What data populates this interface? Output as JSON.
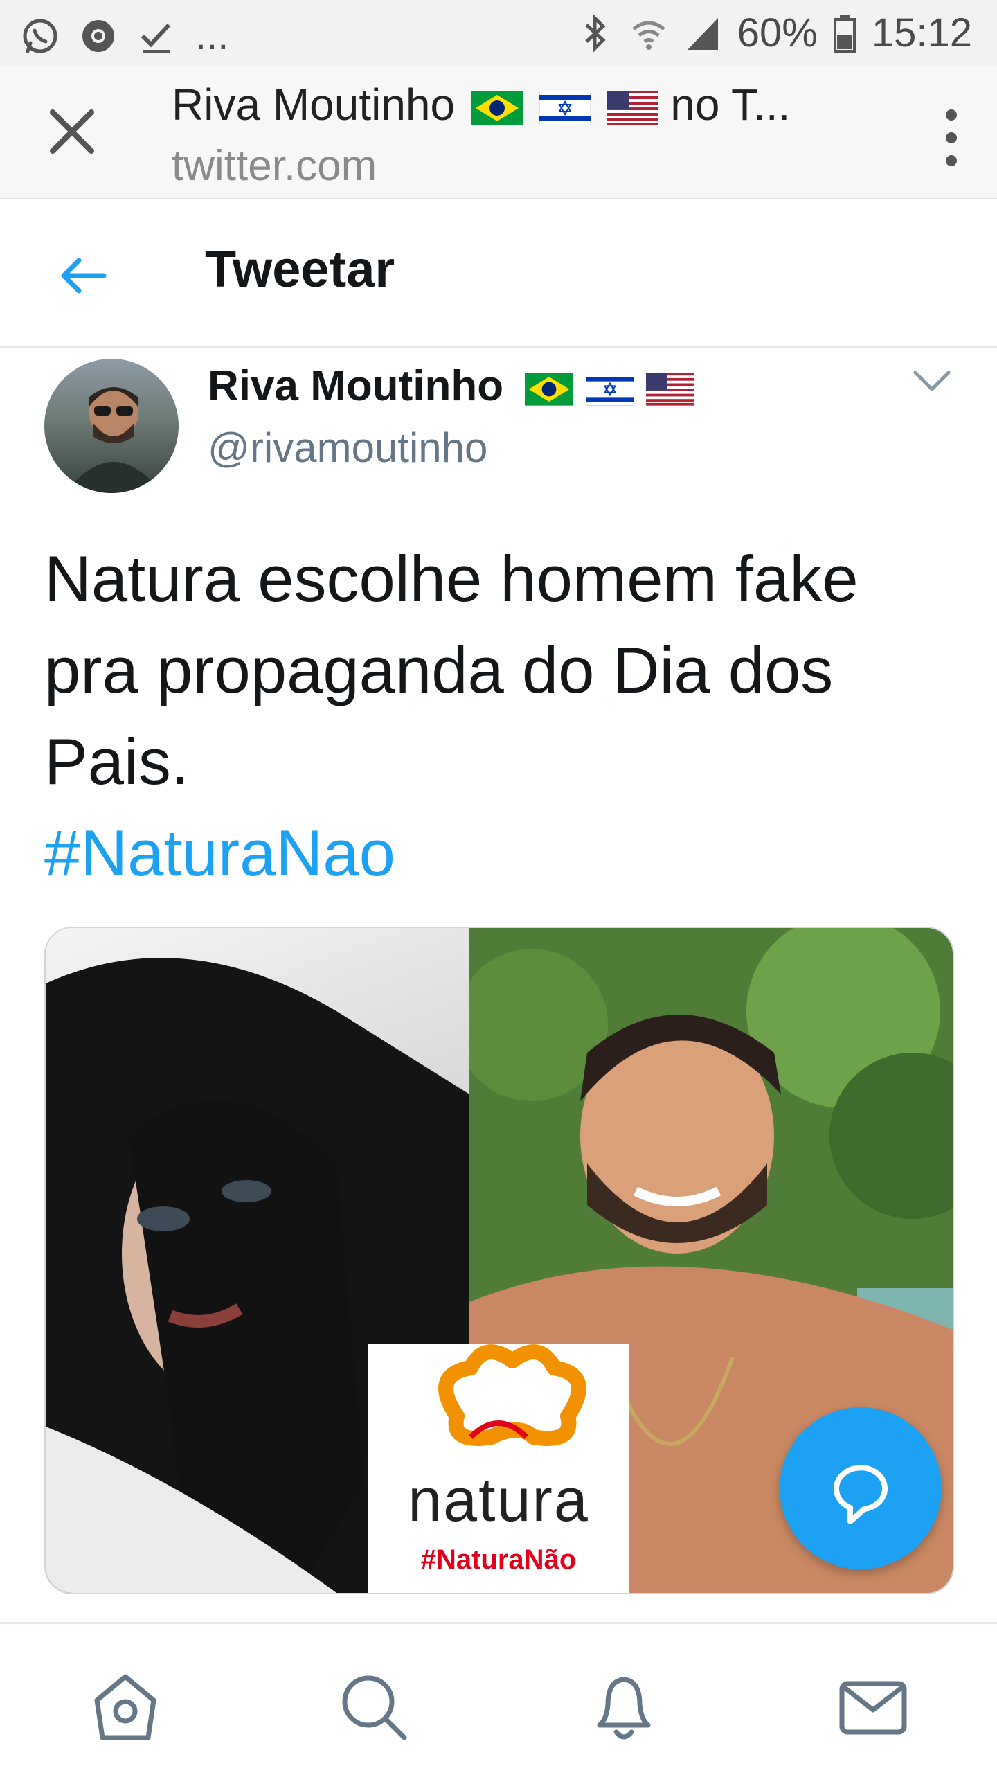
{
  "status_bar": {
    "left_icons": [
      "whatsapp-icon",
      "chrome-icon",
      "download-done-icon",
      "more-dots-icon"
    ],
    "more_text": "...",
    "right_icons": [
      "bluetooth-icon",
      "wifi-icon",
      "signal-icon",
      "battery-icon"
    ],
    "battery": "60%",
    "time": "15:12"
  },
  "browser": {
    "page_title_prefix": "Riva Moutinho",
    "page_title_suffix": "no T...",
    "url": "twitter.com",
    "close_icon": "close-icon",
    "menu_icon": "kebab-menu-icon"
  },
  "tweet_header": {
    "title": "Tweetar",
    "back_icon": "back-arrow-icon"
  },
  "tweet": {
    "author_name": "Riva Moutinho",
    "author_handle": "@rivamoutinho",
    "author_flags": [
      "brazil-flag-icon",
      "israel-flag-icon",
      "usa-flag-icon"
    ],
    "text": "Natura escolhe homem fake pra propaganda do Dia dos Pais.",
    "hashtag": "#NaturaNao",
    "media": {
      "logo_text": "natura",
      "logo_hashtag": "#NaturaNão"
    }
  },
  "fab": {
    "icon": "compose-reply-icon"
  },
  "bottom_nav": {
    "items": [
      "home-icon",
      "search-icon",
      "notifications-icon",
      "messages-icon"
    ]
  },
  "colors": {
    "accent": "#1da1f2",
    "text": "#14171a",
    "secondary_text": "#657786",
    "logo_red": "#e4001b",
    "logo_orange": "#f39200"
  }
}
